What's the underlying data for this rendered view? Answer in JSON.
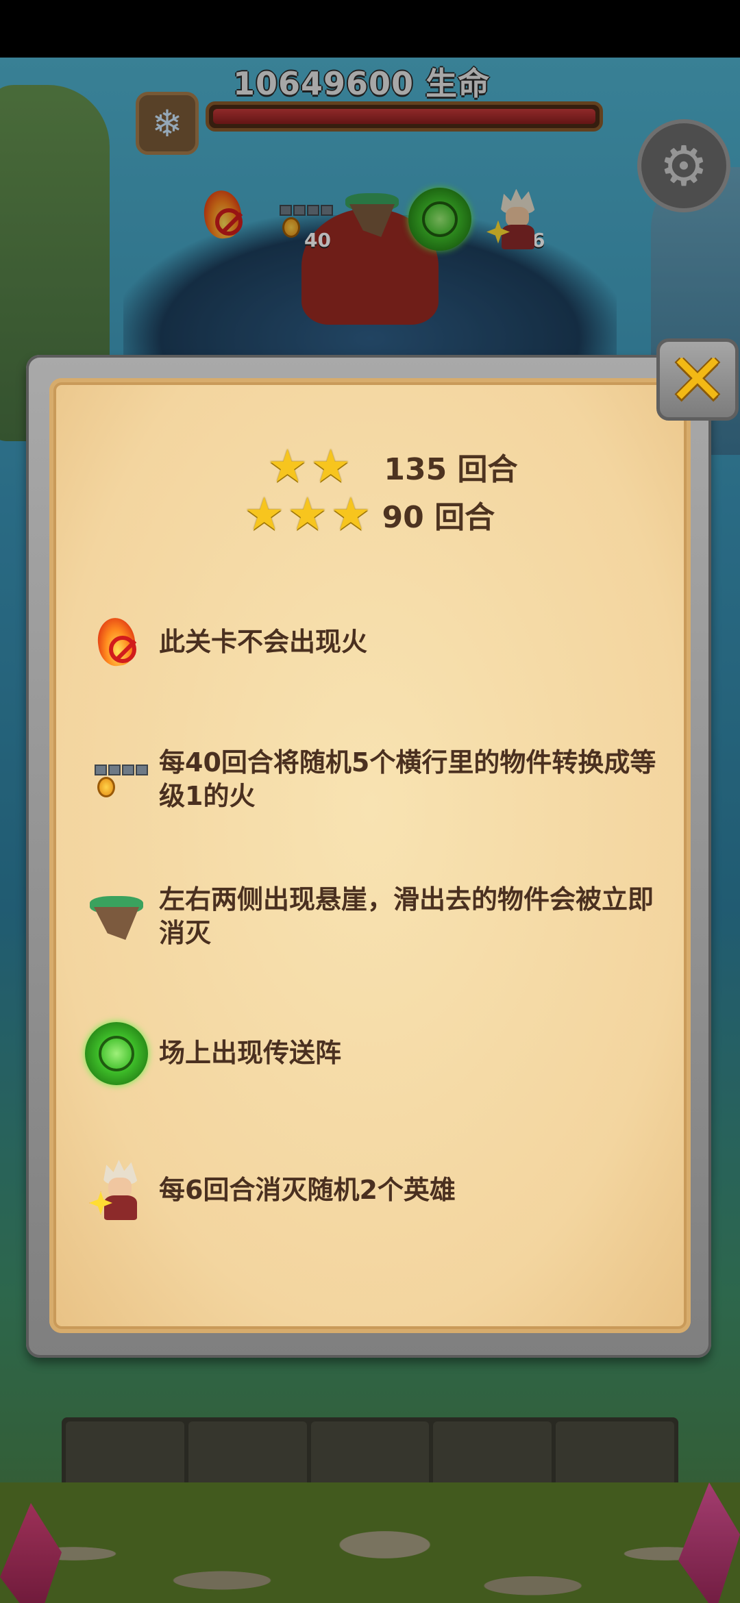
{
  "hud": {
    "boss_hp_value": "10649600",
    "boss_hp_label": "生命",
    "modifier_counts": {
      "convert_rounds": "40",
      "destroy_rounds": "6"
    }
  },
  "icons": {
    "freeze": "snowflake-icon",
    "settings": "gear-icon",
    "close": "close-x-icon",
    "star": "star-icon"
  },
  "popup": {
    "ratings": [
      {
        "stars": 2,
        "text": "135 回合"
      },
      {
        "stars": 3,
        "text": "90 回合"
      }
    ],
    "rules": [
      {
        "icon": "no-fire-icon",
        "text": "此关卡不会出现火"
      },
      {
        "icon": "row-fire-convert-icon",
        "text": "每40回合将随机5个横行里的物件转换成等级1的火"
      },
      {
        "icon": "floating-cliff-icon",
        "text": "左右两侧出现悬崖，滑出去的物件会被立即消灭"
      },
      {
        "icon": "teleport-portal-icon",
        "text": "场上出现传送阵"
      },
      {
        "icon": "hero-destroy-icon",
        "text": "每6回合消灭随机2个英雄"
      }
    ]
  },
  "colors": {
    "parchment": "#f3d59f",
    "text_brown": "#4a3020",
    "star_gold": "#f7c51e",
    "close_x_gold": "#f2b915",
    "hp_red": "#c63a3a"
  }
}
